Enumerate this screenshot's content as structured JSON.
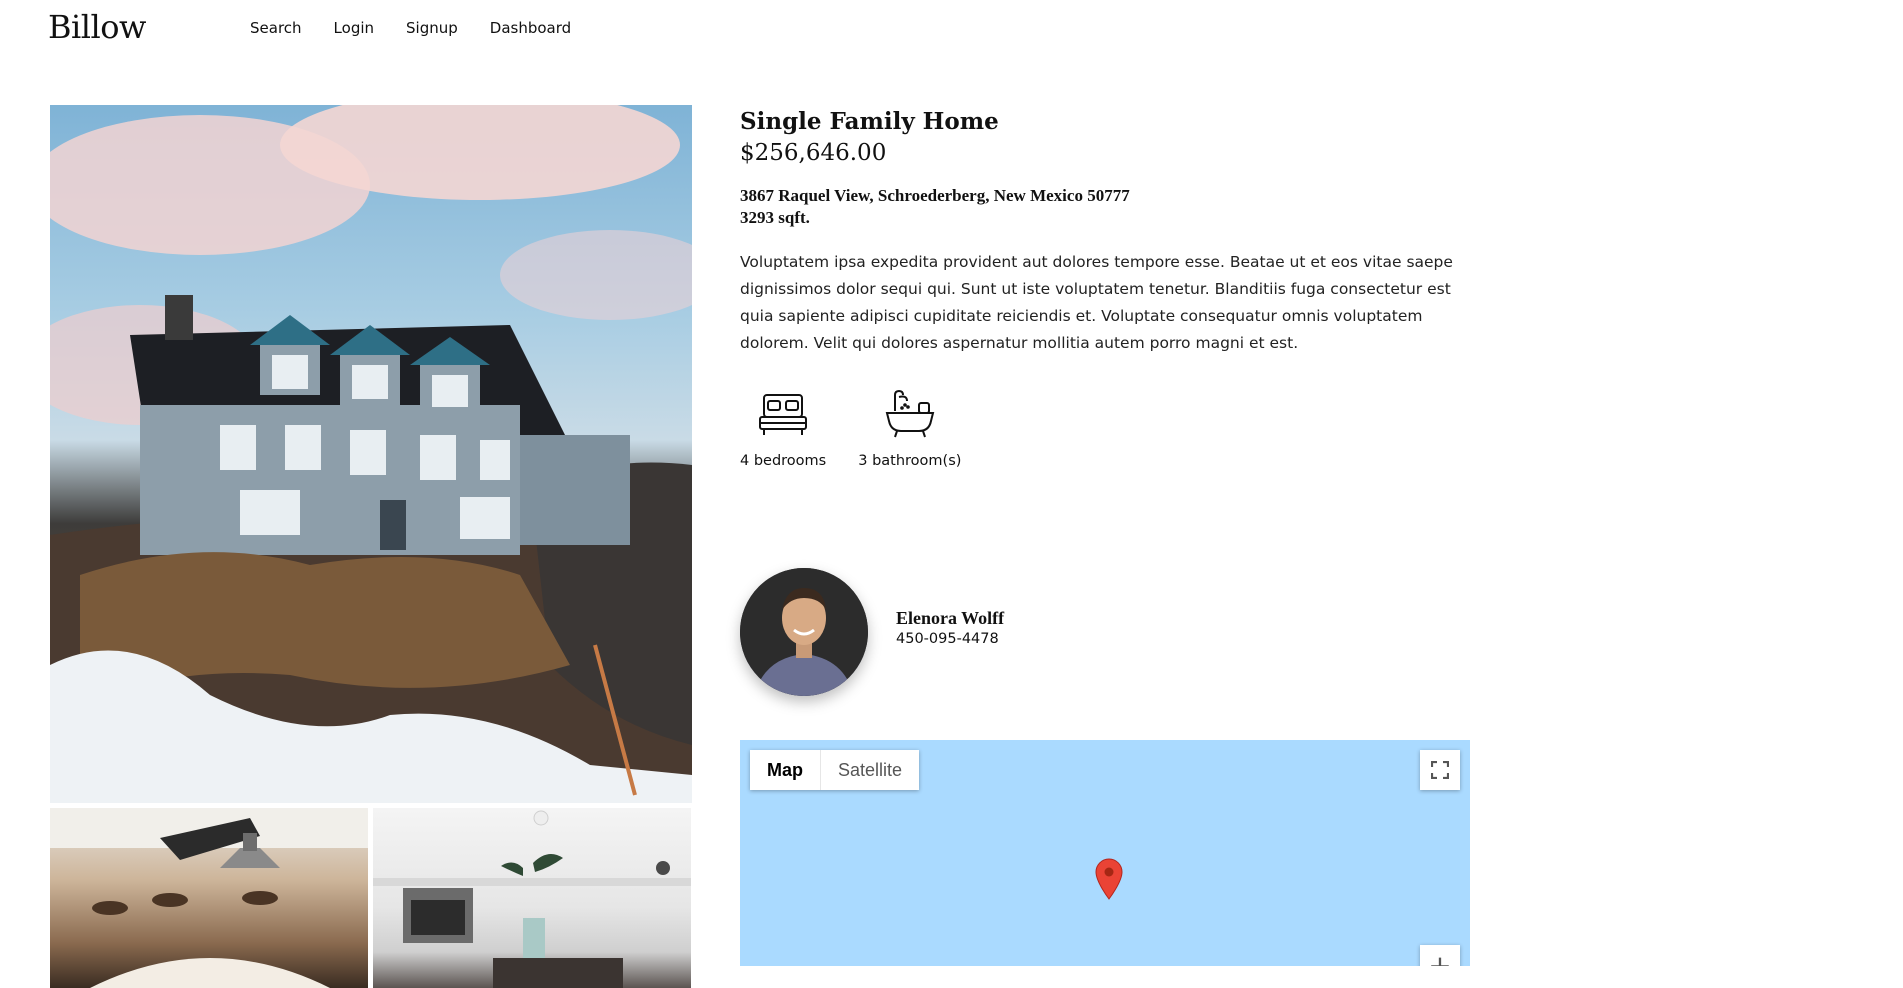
{
  "brand": {
    "name": "Billow"
  },
  "nav": {
    "items": [
      "Search",
      "Login",
      "Signup",
      "Dashboard"
    ]
  },
  "listing": {
    "type": "Single Family Home",
    "price": "$256,646.00",
    "address": "3867 Raquel View, Schroederberg, New Mexico 50777",
    "size": "3293 sqft.",
    "description": "Voluptatem ipsa expedita provident aut dolores tempore esse. Beatae ut et eos vitae saepe dignissimos dolor sequi qui. Sunt ut iste voluptatem tenetur. Blanditiis fuga consectetur est quia sapiente adipisci cupiditate reiciendis et. Voluptate consequatur omnis voluptatem dolorem. Velit qui dolores aspernatur mollitia autem porro magni et est.",
    "features": [
      {
        "icon": "bed-icon",
        "label": "4 bedrooms"
      },
      {
        "icon": "bathtub-icon",
        "label": "3 bathroom(s)"
      }
    ]
  },
  "agent": {
    "name": "Elenora Wolff",
    "phone": "450-095-4478"
  },
  "map": {
    "type_buttons": [
      "Map",
      "Satellite"
    ],
    "selected_type": "Map",
    "water_color": "#aadaff",
    "pin_color": "#ea4335",
    "zoom_in_label": "+"
  },
  "photos": [
    {
      "name": "house-exterior-photo"
    },
    {
      "name": "living-room-photo"
    },
    {
      "name": "kitchen-photo"
    }
  ]
}
